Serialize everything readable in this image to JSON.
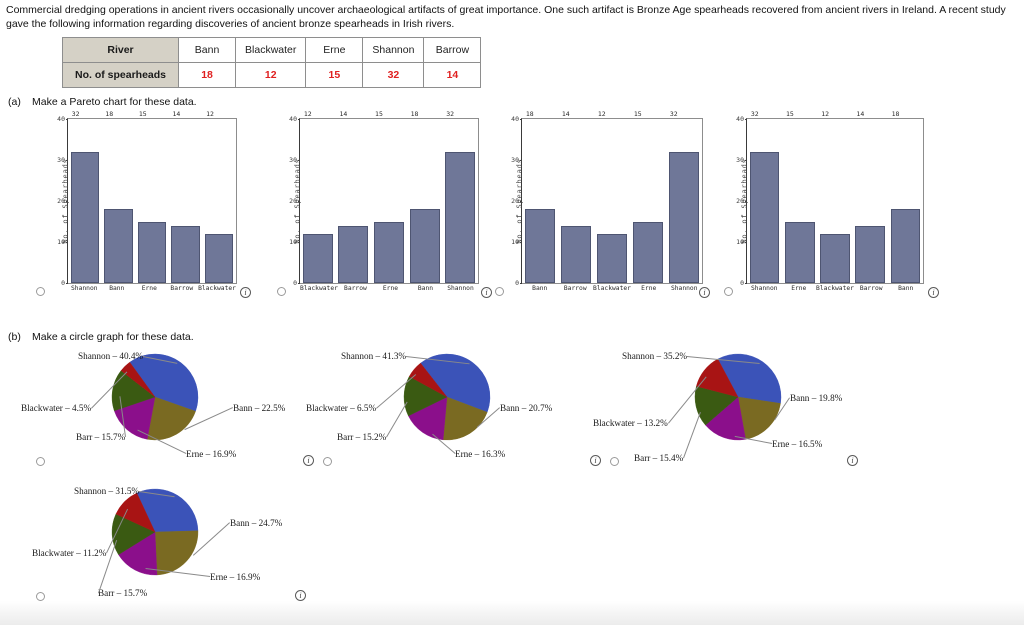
{
  "intro": {
    "paragraph": "Commercial dredging operations in ancient rivers occasionally uncover archaeological artifacts of great importance. One such artifact is Bronze Age spearheads recovered from ancient rivers in Ireland. A recent study gave the following information regarding discoveries of ancient bronze spearheads in Irish rivers."
  },
  "table": {
    "row_headers": [
      "River",
      "No. of spearheads"
    ],
    "rivers": [
      "Bann",
      "Blackwater",
      "Erne",
      "Shannon",
      "Barrow"
    ],
    "counts": [
      "18",
      "12",
      "15",
      "32",
      "14"
    ],
    "header_bg": "#d5d1c6",
    "number_color": "#e02020"
  },
  "parts": {
    "a": {
      "letter": "(a)",
      "text": "Make a Pareto chart for these data."
    },
    "b": {
      "letter": "(b)",
      "text": "Make a circle graph for these data."
    }
  },
  "icons": {
    "info": "i",
    "info_name": "info-icon",
    "radio_name": "radio-button"
  },
  "chart_data": [
    {
      "type": "bar",
      "option_index": 0,
      "title": "",
      "xlabel": "",
      "ylabel": "No. of Spearheads",
      "ylim": [
        0,
        40
      ],
      "yticks": [
        40,
        30,
        20,
        10,
        0
      ],
      "grid": false,
      "bar_color": "#6f7798",
      "categories": [
        "Shannon",
        "Bann",
        "Erne",
        "Barrow",
        "Blackwater"
      ],
      "values": [
        32,
        18,
        15,
        14,
        12
      ]
    },
    {
      "type": "bar",
      "option_index": 1,
      "title": "",
      "xlabel": "",
      "ylabel": "No. of Spearheads",
      "ylim": [
        0,
        40
      ],
      "yticks": [
        40,
        30,
        20,
        10,
        0
      ],
      "grid": false,
      "bar_color": "#6f7798",
      "categories": [
        "Blackwater",
        "Barrow",
        "Erne",
        "Bann",
        "Shannon"
      ],
      "values": [
        12,
        14,
        15,
        18,
        32
      ]
    },
    {
      "type": "bar",
      "option_index": 2,
      "title": "",
      "xlabel": "",
      "ylabel": "No. of Spearheads",
      "ylim": [
        0,
        40
      ],
      "yticks": [
        40,
        30,
        20,
        10,
        0
      ],
      "grid": false,
      "bar_color": "#6f7798",
      "categories": [
        "Bann",
        "Barrow",
        "Blackwater",
        "Erne",
        "Shannon"
      ],
      "values": [
        18,
        14,
        12,
        15,
        32
      ]
    },
    {
      "type": "bar",
      "option_index": 3,
      "title": "",
      "xlabel": "",
      "ylabel": "No. of Spearheads",
      "ylim": [
        0,
        40
      ],
      "yticks": [
        40,
        30,
        20,
        10,
        0
      ],
      "grid": false,
      "bar_color": "#6f7798",
      "categories": [
        "Shannon",
        "Erne",
        "Blackwater",
        "Barrow",
        "Bann"
      ],
      "values": [
        32,
        15,
        12,
        14,
        18
      ]
    },
    {
      "type": "pie",
      "option_index": 4,
      "title": "",
      "labels": [
        "Shannon",
        "Bann",
        "Erne",
        "Barr",
        "Blackwater"
      ],
      "values": [
        40.4,
        22.5,
        16.9,
        15.7,
        4.5
      ],
      "value_unit": "%",
      "colors": [
        "#3b53b8",
        "#7a6a22",
        "#8b0f8b",
        "#3a5a12",
        "#a81414"
      ],
      "label_texts": [
        "Shannon – 40.4%",
        "Bann – 22.5%",
        "Erne – 16.9%",
        "Barr – 15.7%",
        "Blackwater – 4.5%"
      ]
    },
    {
      "type": "pie",
      "option_index": 5,
      "title": "",
      "labels": [
        "Shannon",
        "Bann",
        "Erne",
        "Barr",
        "Blackwater"
      ],
      "values": [
        41.3,
        20.7,
        16.3,
        15.2,
        6.5
      ],
      "value_unit": "%",
      "colors": [
        "#3b53b8",
        "#7a6a22",
        "#8b0f8b",
        "#3a5a12",
        "#a81414"
      ],
      "label_texts": [
        "Shannon – 41.3%",
        "Bann – 20.7%",
        "Erne – 16.3%",
        "Barr – 15.2%",
        "Blackwater – 6.5%"
      ]
    },
    {
      "type": "pie",
      "option_index": 6,
      "title": "",
      "labels": [
        "Shannon",
        "Bann",
        "Erne",
        "Barr",
        "Blackwater"
      ],
      "values": [
        35.2,
        19.8,
        16.5,
        15.4,
        13.2
      ],
      "value_unit": "%",
      "colors": [
        "#3b53b8",
        "#7a6a22",
        "#8b0f8b",
        "#3a5a12",
        "#a81414"
      ],
      "label_texts": [
        "Shannon – 35.2%",
        "Bann – 19.8%",
        "Erne – 16.5%",
        "Barr – 15.4%",
        "Blackwater – 13.2%"
      ]
    },
    {
      "type": "pie",
      "option_index": 7,
      "title": "",
      "labels": [
        "Shannon",
        "Bann",
        "Erne",
        "Barr",
        "Blackwater"
      ],
      "values": [
        31.5,
        24.7,
        16.9,
        15.7,
        11.2
      ],
      "value_unit": "%",
      "colors": [
        "#3b53b8",
        "#7a6a22",
        "#8b0f8b",
        "#3a5a12",
        "#a81414"
      ],
      "label_texts": [
        "Shannon – 31.5%",
        "Bann – 24.7%",
        "Erne – 16.9%",
        "Barr – 15.7%",
        "Blackwater – 11.2%"
      ]
    }
  ]
}
